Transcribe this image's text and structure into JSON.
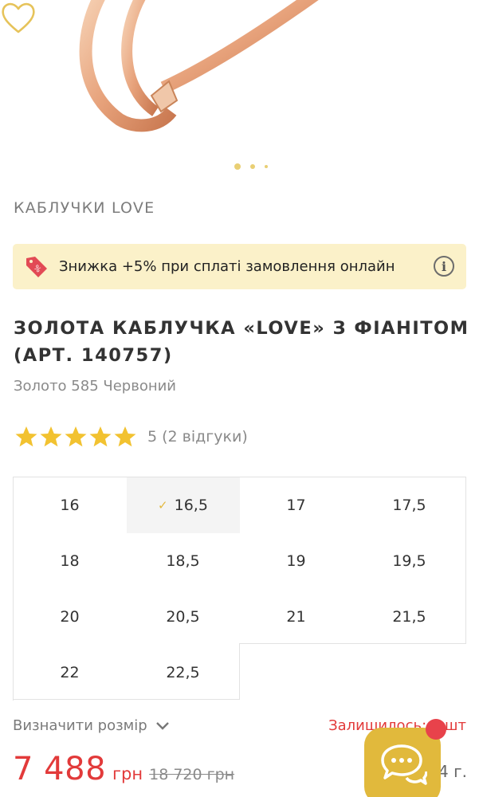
{
  "gallery": {
    "favorite_icon": "heart-outline-icon",
    "dots": 3,
    "active_dot": 1
  },
  "collection": "КАБЛУЧКИ LOVE",
  "promo": {
    "icon": "discount-tag-icon",
    "text": "Знижка +5% при сплаті замовлення онлайн",
    "info_icon": "info-icon",
    "info_glyph": "i"
  },
  "product": {
    "title": "ЗОЛОТА КАБЛУЧКА «LOVE» З ФІАНІТОМ (АРТ. 140757)",
    "meta": "Золото 585 Червоний"
  },
  "rating": {
    "stars": 5,
    "max": 5,
    "text": "5 (2 відгуки)",
    "star_color": "#f2c230"
  },
  "sizes": {
    "selected": "16,5",
    "check_glyph": "✓",
    "items": [
      "16",
      "16,5",
      "17",
      "17,5",
      "18",
      "18,5",
      "19",
      "19,5",
      "20",
      "20,5",
      "21",
      "21,5",
      "22",
      "22,5"
    ]
  },
  "size_guide": {
    "label": "Визначити розмір",
    "icon": "chevron-down-icon"
  },
  "stock": "Залишилось: 1 шт",
  "price": {
    "current": "7 488",
    "currency": "грн",
    "old": "18 720 грн",
    "weight": "4 г."
  },
  "chat": {
    "icon": "chat-bubbles-icon",
    "badge_color": "#e8424b",
    "button_color": "#e1b93c"
  },
  "colors": {
    "accent": "#e1b93c",
    "sale": "#e23a3a",
    "promo_bg": "#fbf1c9"
  }
}
